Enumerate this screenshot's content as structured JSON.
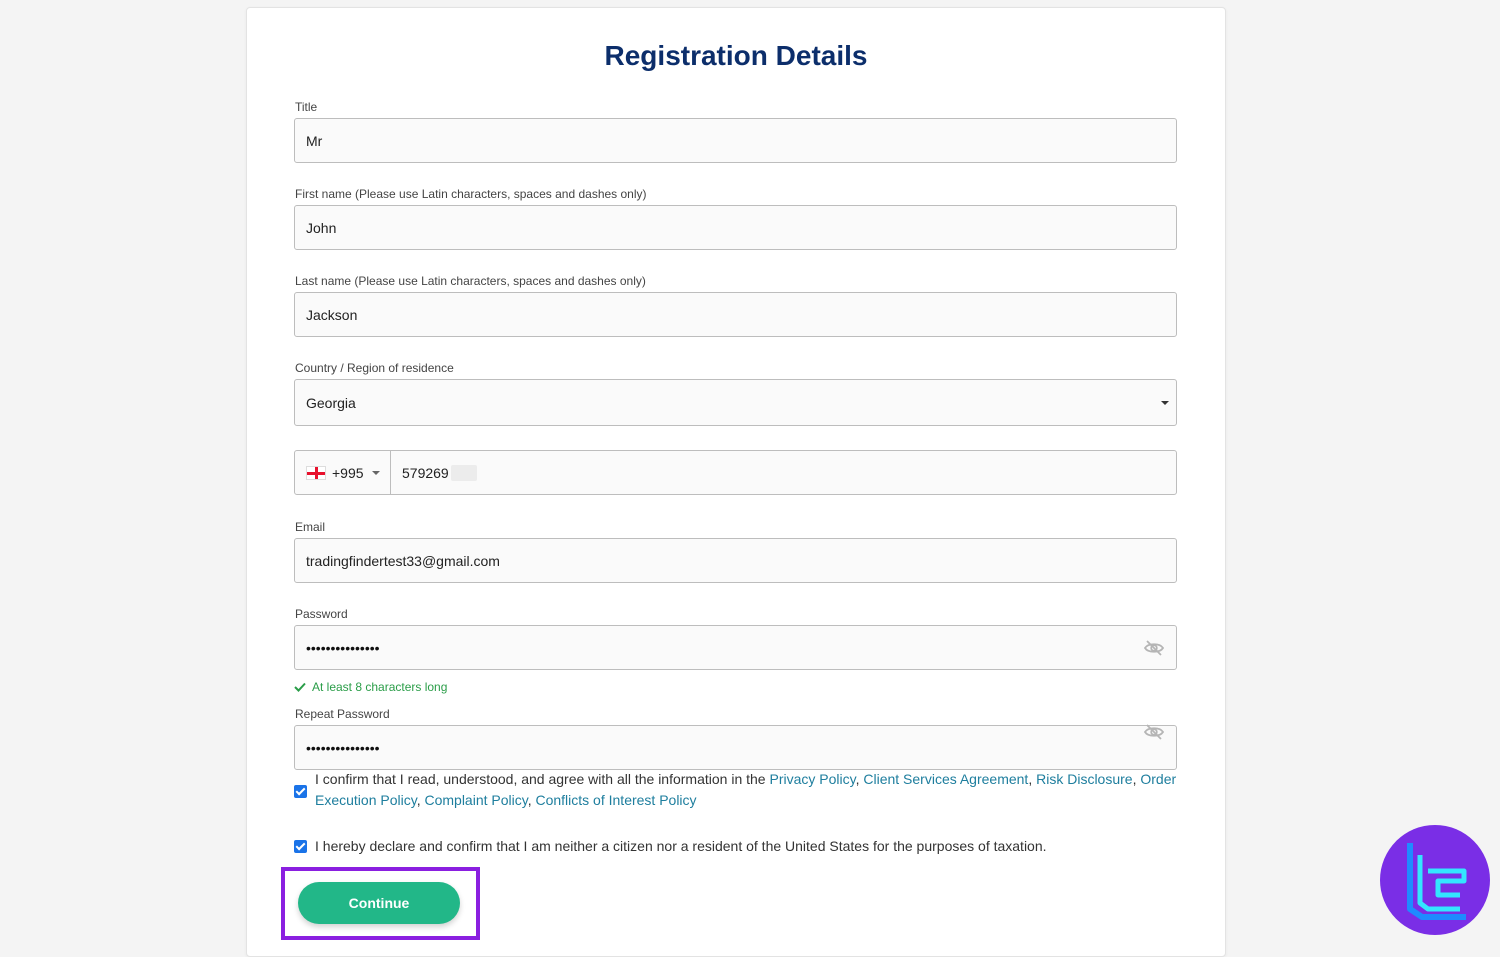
{
  "form": {
    "title": "Registration Details",
    "title_label": "Title",
    "title_value": "Mr",
    "first_name_label": "First name (Please use Latin characters, spaces and dashes only)",
    "first_name_value": "John",
    "last_name_label": "Last name (Please use Latin characters, spaces and dashes only)",
    "last_name_value": "Jackson",
    "country_label": "Country / Region of residence",
    "country_value": "Georgia",
    "phone_code": "+995",
    "phone_flag": "georgia-flag-icon",
    "phone_value": "579269",
    "email_label": "Email",
    "email_value": "tradingfindertest33@gmail.com",
    "password_label": "Password",
    "password_value": "•••••••••••••••",
    "password_hint": "At least 8 characters long",
    "repeat_password_label": "Repeat Password",
    "repeat_password_value": "•••••••••••••••",
    "consent_text": "I confirm that I read, understood, and agree with all the information in the",
    "consent_links": [
      "Privacy Policy",
      "Client Services Agreement",
      "Risk Disclosure",
      "Order Execution Policy",
      "Complaint Policy",
      "Conflicts of Interest Policy"
    ],
    "consent_checked": true,
    "us_declaration_text": "I hereby declare and confirm that I am neither a citizen nor a resident of the United States for the purposes of taxation.",
    "us_declaration_checked": true,
    "continue_label": "Continue"
  },
  "colors": {
    "title": "#0c2e6b",
    "continue_button": "#22b788",
    "link": "#1e7e9e",
    "hint": "#2a9d48",
    "highlight_border": "#8a1fe0",
    "logo_bg": "#7a2ee6"
  },
  "logo": {
    "icon": "tradingfinder-logo-icon"
  }
}
